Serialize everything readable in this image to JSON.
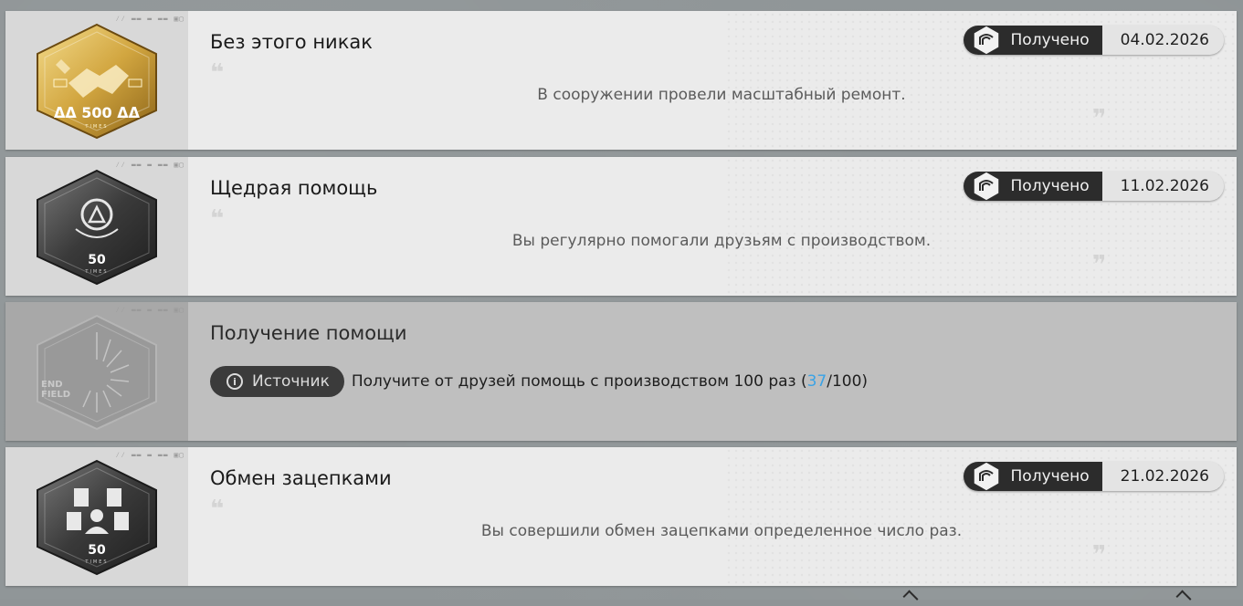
{
  "achievements": [
    {
      "title": "Без этого никак",
      "description": "В сооружении провели масштабный ремонт.",
      "status": "Получено",
      "date": "04.02.2026",
      "badge": {
        "style": "gold",
        "number": "500",
        "sub": "TIMES"
      }
    },
    {
      "title": "Щедрая помощь",
      "description": "Вы регулярно помогали друзьям с производством.",
      "status": "Получено",
      "date": "11.02.2026",
      "badge": {
        "style": "dark",
        "number": "50",
        "sub": "TIMES"
      }
    },
    {
      "title": "Получение помощи",
      "locked": true,
      "source_label": "Источник",
      "requirement_prefix": "Получите от друзей помощь с производством 100 раз (",
      "progress_current": "37",
      "progress_suffix": "/100)",
      "badge": {
        "style": "locked",
        "logo": "END FIELD"
      }
    },
    {
      "title": "Обмен зацепками",
      "description": "Вы совершили обмен зацепками определенное число раз.",
      "status": "Получено",
      "date": "21.02.2026",
      "badge": {
        "style": "dark",
        "number": "50",
        "sub": "TIMES"
      }
    }
  ],
  "colors": {
    "progress_accent": "#3aa3e6",
    "status_dark": "#2c2c2c",
    "gold": "#c9a24a"
  }
}
